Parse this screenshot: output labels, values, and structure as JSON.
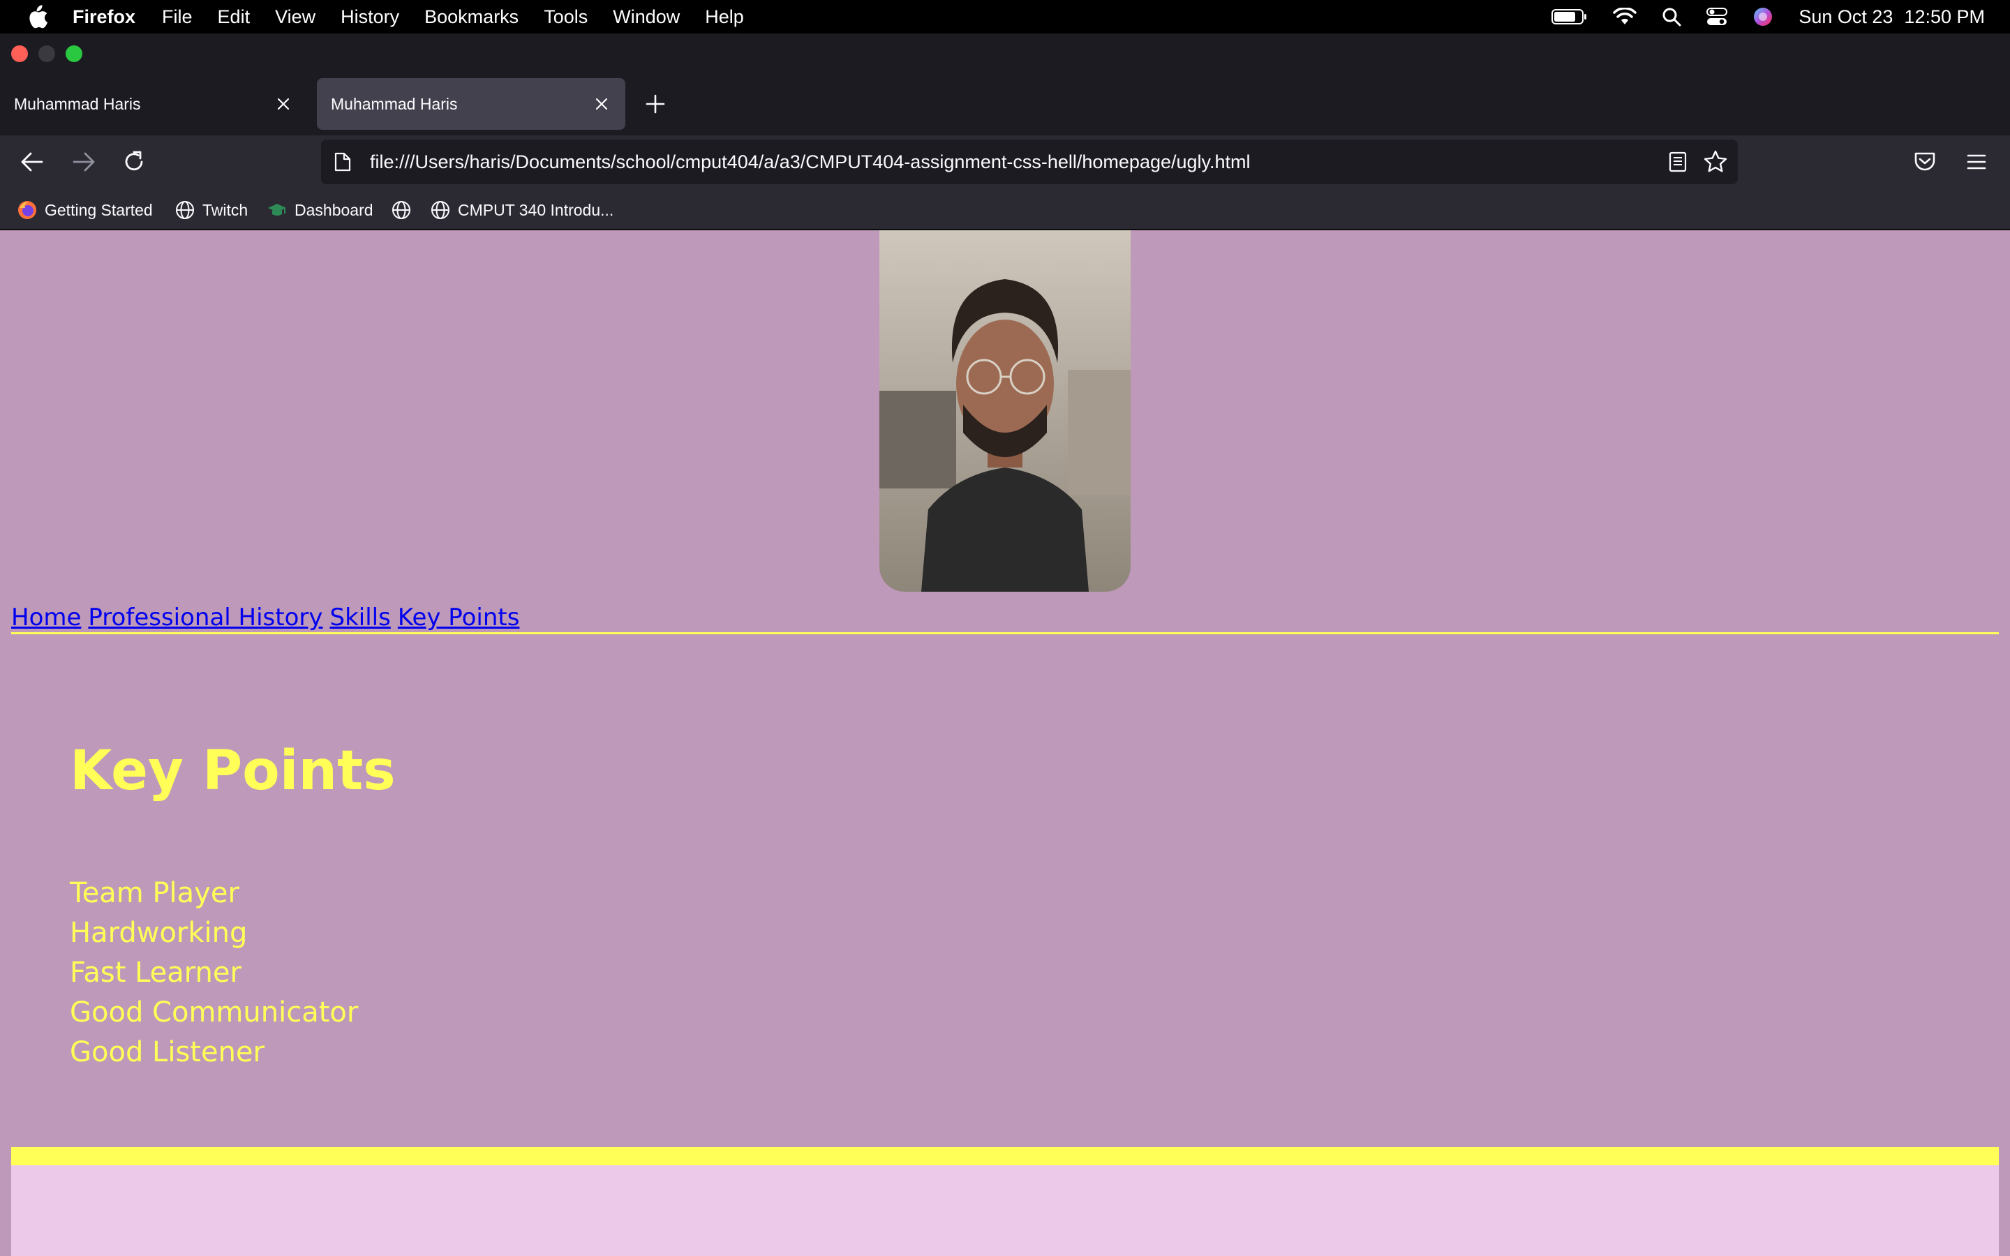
{
  "menubar": {
    "app_name": "Firefox",
    "items": [
      "File",
      "Edit",
      "View",
      "History",
      "Bookmarks",
      "Tools",
      "Window",
      "Help"
    ],
    "clock_date": "Sun Oct 23",
    "clock_time": "12:50 PM"
  },
  "tabs": [
    {
      "title": "Muhammad Haris",
      "active": false
    },
    {
      "title": "Muhammad Haris",
      "active": true
    }
  ],
  "address_bar": {
    "url": "file:///Users/haris/Documents/school/cmput404/a/a3/CMPUT404-assignment-css-hell/homepage/ugly.html"
  },
  "bookmarks": [
    {
      "label": "Getting Started",
      "icon": "firefox-icon"
    },
    {
      "label": "Twitch",
      "icon": "globe-icon"
    },
    {
      "label": "Dashboard",
      "icon": "graduation-cap-icon"
    },
    {
      "label": "",
      "icon": "globe-icon"
    },
    {
      "label": "CMPUT 340 Introdu...",
      "icon": "globe-icon"
    }
  ],
  "page": {
    "nav_links": [
      "Home",
      "Professional History",
      "Skills",
      "Key Points"
    ],
    "section_title": "Key Points",
    "key_points": [
      "Team Player",
      "Hardworking",
      "Fast Learner",
      "Good Communicator",
      "Good Listener"
    ]
  },
  "colors": {
    "page_background": "#bf99b9",
    "accent_yellow": "#ffff57",
    "link_blue": "#0000ee",
    "footer_pink": "#ecc8e9"
  }
}
